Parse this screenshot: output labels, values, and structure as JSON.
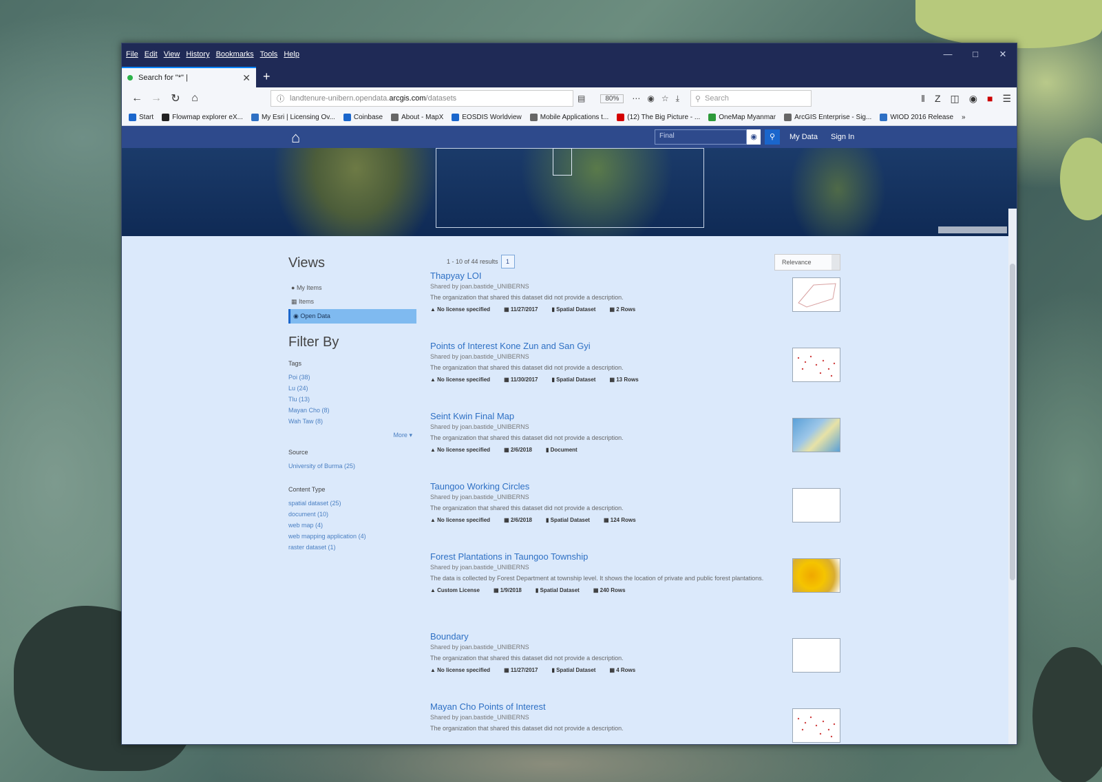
{
  "browser": {
    "menu": [
      "File",
      "Edit",
      "View",
      "History",
      "Bookmarks",
      "Tools",
      "Help"
    ],
    "tab_title": "Search for \"*\" |",
    "url_prefix": "landtenure-unibern.opendata.",
    "url_domain": "arcgis.com",
    "url_path": "/datasets",
    "zoom": "80%",
    "search_placeholder": "Search",
    "bookmarks": [
      {
        "label": "Start",
        "color": "#1a66cc"
      },
      {
        "label": "Flowmap explorer eX...",
        "color": "#222222"
      },
      {
        "label": "My Esri | Licensing Ov...",
        "color": "#2e70c4"
      },
      {
        "label": "Coinbase",
        "color": "#1a66cc"
      },
      {
        "label": "About - MapX",
        "color": "#666666"
      },
      {
        "label": "EOSDIS Worldview",
        "color": "#1a66cc"
      },
      {
        "label": "Mobile Applications t...",
        "color": "#666666"
      },
      {
        "label": "(12) The Big Picture - ...",
        "color": "#d40000"
      },
      {
        "label": "OneMap Myanmar",
        "color": "#2d9a3a"
      },
      {
        "label": "ArcGIS Enterprise - Sig...",
        "color": "#666666"
      },
      {
        "label": "WIOD 2016 Release",
        "color": "#2e70c4"
      }
    ]
  },
  "site": {
    "search_value": "Final",
    "my_data": "My Data",
    "sign_in": "Sign In"
  },
  "sidebar": {
    "views_heading": "Views",
    "views": [
      {
        "label": "My Items",
        "active": false
      },
      {
        "label": "Items",
        "active": false
      },
      {
        "label": "Open Data",
        "active": true
      }
    ],
    "filter_heading": "Filter By",
    "tags_heading": "Tags",
    "tags": [
      "Poi (38)",
      "Lu (24)",
      "Tlu (13)",
      "Mayan Cho (8)",
      "Wah Taw (8)"
    ],
    "more_label": "More",
    "source_heading": "Source",
    "sources": [
      "University of Burma (25)"
    ],
    "content_type_heading": "Content Type",
    "content_types": [
      "spatial dataset (25)",
      "document (10)",
      "web map (4)",
      "web mapping application (4)",
      "raster dataset (1)"
    ]
  },
  "results": {
    "count": "1 - 10 of 44 results",
    "page": "1",
    "sort": "Relevance",
    "items": [
      {
        "title": "Thapyay LOI",
        "owner": "Shared by joan.bastide_UNIBERNS",
        "desc": "The organization that shared this dataset did not provide a description.",
        "license": "No license specified",
        "date": "11/27/2017",
        "type": "Spatial Dataset",
        "rows": "2 Rows",
        "thumb": "outline"
      },
      {
        "title": "Points of Interest Kone Zun and San Gyi",
        "owner": "Shared by joan.bastide_UNIBERNS",
        "desc": "The organization that shared this dataset did not provide a description.",
        "license": "No license specified",
        "date": "11/30/2017",
        "type": "Spatial Dataset",
        "rows": "13 Rows",
        "thumb": "dots"
      },
      {
        "title": "Seint Kwin Final Map",
        "owner": "Shared by joan.bastide_UNIBERNS",
        "desc": "The organization that shared this dataset did not provide a description.",
        "license": "No license specified",
        "date": "2/6/2018",
        "type": "Document",
        "rows": "",
        "thumb": "map"
      },
      {
        "title": "Taungoo Working Circles",
        "owner": "Shared by joan.bastide_UNIBERNS",
        "desc": "The organization that shared this dataset did not provide a description.",
        "license": "No license specified",
        "date": "2/6/2018",
        "type": "Spatial Dataset",
        "rows": "124 Rows",
        "thumb": "blank"
      },
      {
        "title": "Forest Plantations in Taungoo Township",
        "owner": "Shared by joan.bastide_UNIBERNS",
        "desc": "The data is collected by Forest Department at township level. It shows the location of private and public forest plantations.",
        "license": "Custom License",
        "date": "1/9/2018",
        "type": "Spatial Dataset",
        "rows": "240 Rows",
        "thumb": "orange"
      },
      {
        "title": "Boundary",
        "owner": "Shared by joan.bastide_UNIBERNS",
        "desc": "The organization that shared this dataset did not provide a description.",
        "license": "No license specified",
        "date": "11/27/2017",
        "type": "Spatial Dataset",
        "rows": "4 Rows",
        "thumb": "blank"
      },
      {
        "title": "Mayan Cho Points of Interest",
        "owner": "Shared by joan.bastide_UNIBERNS",
        "desc": "The organization that shared this dataset did not provide a description.",
        "license": "",
        "date": "",
        "type": "",
        "rows": "",
        "thumb": "dots"
      }
    ]
  }
}
